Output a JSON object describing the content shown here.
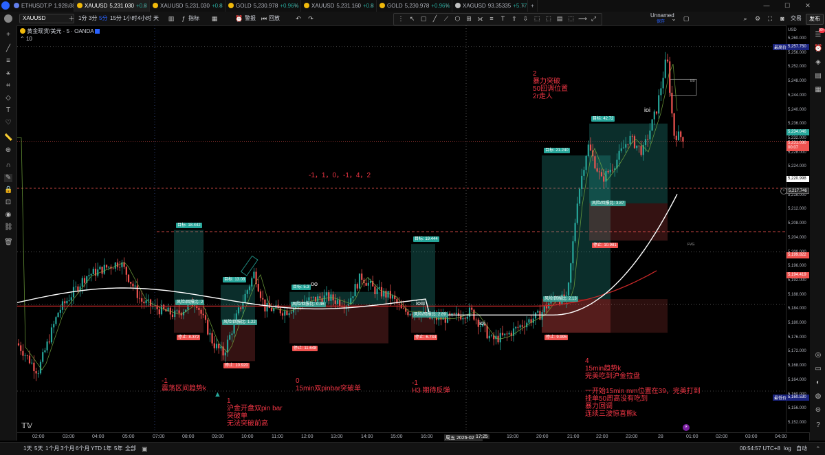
{
  "tabs": [
    {
      "symbol": "ETHUSDT.P",
      "price": "1,928.38",
      "change": "-6.3",
      "color": "#627eea",
      "active": false
    },
    {
      "symbol": "XAUUSD",
      "price": "5,231.030",
      "change": "+0.8",
      "color": "#f0b90b",
      "active": true
    },
    {
      "symbol": "XAUUSD",
      "price": "5,231.030",
      "change": "+0.8",
      "color": "#f0b90b",
      "active": false
    },
    {
      "symbol": "GOLD",
      "price": "5,230.978",
      "change": "+0.96%",
      "color": "#f0b90b",
      "active": false
    },
    {
      "symbol": "XAUUSD",
      "price": "5,231.160",
      "change": "+0.8",
      "color": "#f0b90b",
      "active": false
    },
    {
      "symbol": "GOLD",
      "price": "5,230.978",
      "change": "+0.96%",
      "color": "#f0b90b",
      "active": false
    },
    {
      "symbol": "XAGUSD",
      "price": "93.35335",
      "change": "+5.77",
      "color": "#c0c0c0",
      "active": false
    }
  ],
  "toolbar": {
    "symbol": "XAUUSD",
    "timeframes": [
      "1分",
      "3分",
      "5分",
      "15分",
      "1小时",
      "4小时",
      "天"
    ],
    "indicators": "指标",
    "alert": "警报",
    "replay": "回放",
    "layout_name": "Unnamed",
    "layout_sub": "保存",
    "trade": "交易",
    "publish": "发布"
  },
  "legend": {
    "title": "黄金现货/美元 · 5 · OANDA",
    "sub": "10"
  },
  "price_axis": {
    "currency": "USD",
    "ticks": [
      "5,260.000",
      "5,256.000",
      "5,252.000",
      "5,248.000",
      "5,244.000",
      "5,240.000",
      "5,236.000",
      "5,232.000",
      "5,228.000",
      "5,224.000",
      "5,220.000",
      "5,216.000",
      "5,212.000",
      "5,208.000",
      "5,204.000",
      "5,200.000",
      "5,196.000",
      "5,192.000",
      "5,188.000",
      "5,184.000",
      "5,180.000",
      "5,176.000",
      "5,172.000",
      "5,168.000",
      "5,164.000",
      "5,160.000",
      "5,156.000",
      "5,152.000"
    ],
    "high_label": "最高价",
    "high_value": "5,257.750",
    "low_label": "最低价",
    "low_value": "5,160.530",
    "last_a": "5,234.046",
    "last_b": "5,231.030",
    "countdown": "00:07",
    "level_a": "5,220.998",
    "level_b": "5,217.746",
    "level_c": "5,199.822",
    "level_d": "5,194.419"
  },
  "time_axis": {
    "labels": [
      "02:00",
      "03:00",
      "04:00",
      "05:00",
      "07:00",
      "08:00",
      "09:00",
      "10:00",
      "11:00",
      "12:00",
      "13:00",
      "14:00",
      "15:00",
      "16:00",
      "周五 2026-02-27",
      "17:25",
      "19:00",
      "20:00",
      "21:00",
      "22:00",
      "23:00",
      "28",
      "01:00",
      "02:00",
      "03:00",
      "04:00"
    ]
  },
  "bottom_bar": {
    "ranges": [
      "1天",
      "5天",
      "1个月",
      "3个月",
      "6个月",
      "YTD",
      "1年",
      "5年",
      "全部"
    ],
    "clock": "00:54:57 UTC+8",
    "log": "log",
    "auto": "自动"
  },
  "annotations": {
    "a1": "-1\n震荡区间趋势k",
    "a2": "1\n沪金开盘双pin bar\n突破单\n无法突破前高",
    "a3": "0\n15min双pinbar突破单",
    "a4": "-1\nH3 期待反弹",
    "a5": "2\n暴力突破\n50回调位置\n2r走人",
    "a6": "4\n15min趋势k\n完美吃到沪金拉盘\n\n一开始15min mm位置在39，完美打到\n挂单50周高没有吃到\n暴力回调\n连续三波惊喜熊k",
    "seq": "-1，1，0，-1，4，2"
  },
  "chart_labels": {
    "oo": "oo",
    "ioiii": "ioiii",
    "ioi1": "ioi",
    "ioi2": "ioi",
    "fvg": "FVG",
    "bb": "BB"
  },
  "positions": [
    {
      "target": "目标: 18.442",
      "rr": "风险/回报比: 2",
      "stop": "停止: 8.372"
    },
    {
      "target": "目标: 13.08",
      "rr": "风险/回报比: 1.22",
      "stop": "停止: 10.920"
    },
    {
      "target": "目标: 5.3",
      "rr": "风险/回报比: 0.46",
      "stop": "停止: 11.648"
    },
    {
      "target": "目标: 19.444",
      "rr": "风险/回报比: 2.89",
      "stop": "停止: 6.734"
    },
    {
      "target": "目标: 21.240",
      "rr": "风险/回报比: 2.13",
      "stop": "停止: 9.995"
    },
    {
      "target": "目标: 42.72",
      "rr": "风险/回报比: 3.87",
      "stop": "停止: 10.981"
    }
  ],
  "colors": {
    "up": "#26a69a",
    "down": "#ef5350",
    "annotation": "#f23645",
    "ma_white": "#ffffff",
    "ma_red": "#c62828",
    "ma_green": "#7cb342"
  }
}
